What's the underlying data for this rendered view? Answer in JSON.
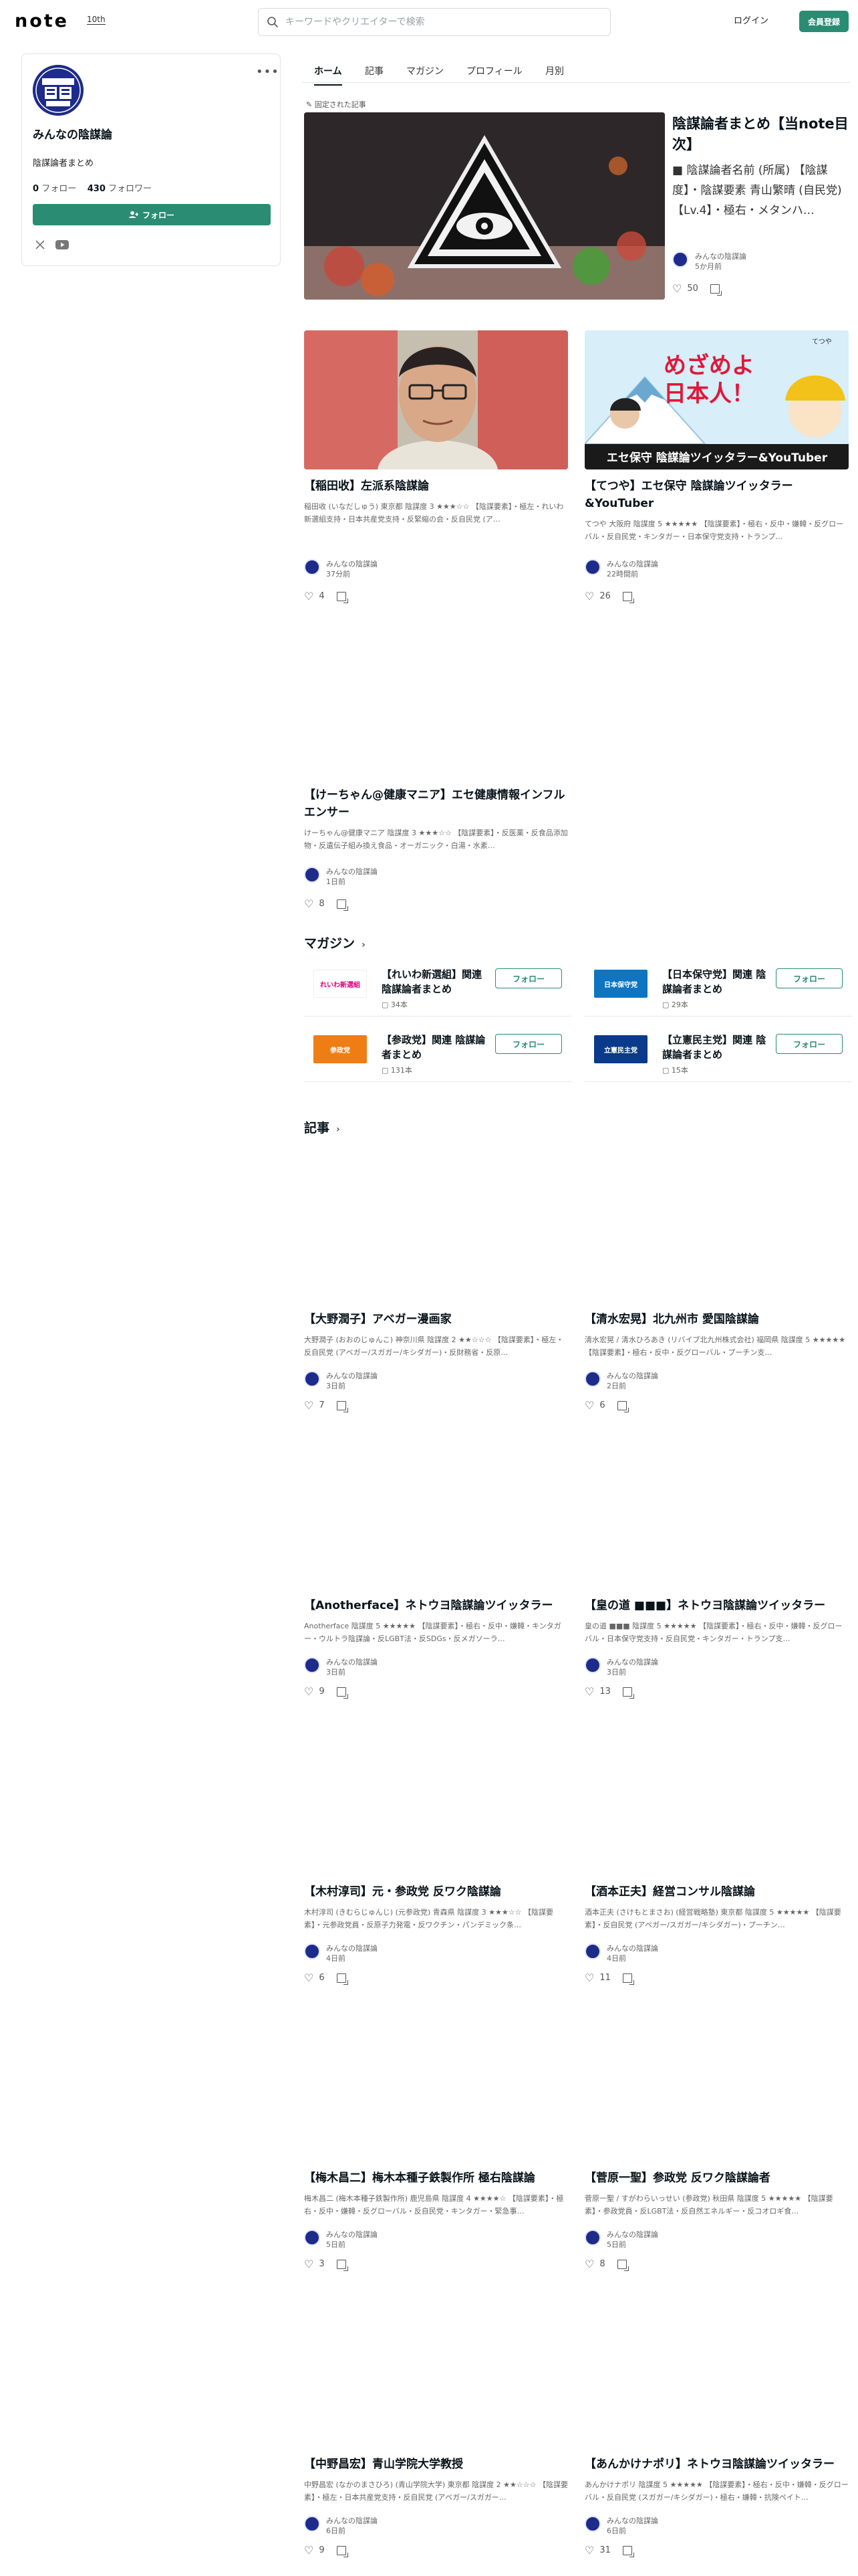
{
  "header": {
    "logo": "note",
    "logo_badge": "10th",
    "search_placeholder": "キーワードやクリエイターで検索",
    "login": "ログイン",
    "signup": "会員登録"
  },
  "profile": {
    "name": "みんなの陰謀論",
    "bio": "陰謀論者まとめ",
    "following_count": "0",
    "following_label": "フォロー",
    "followers_count": "430",
    "followers_label": "フォロワー",
    "follow_button": "フォロー",
    "avatar_text": "みんなの陰謀論"
  },
  "tabs": [
    "ホーム",
    "記事",
    "マガジン",
    "プロフィール",
    "月別"
  ],
  "featured": {
    "pinned_label": "固定された記事",
    "title": "陰謀論者まとめ【当note目次】",
    "desc": "■ 陰謀論者名前 (所属) 【陰謀度】・陰謀要素 青山繁晴 (自民党) 【Lv.4】・極右・メタンハ…",
    "author": "みんなの陰謀論",
    "time": "5か月前",
    "likes": "50"
  },
  "top_cards": [
    {
      "title": "【稲田收】左派系陰謀論",
      "desc": "稲田收 (いなだしゅう) 東京都 陰謀度 3 ★★★☆☆ 【陰謀要素】・極左・れいわ新選組支持・日本共産党支持・反緊縮の会・反自民党 (ア…",
      "author": "みんなの陰謀論",
      "time": "37分前",
      "likes": "4"
    },
    {
      "title": "【てつや】エセ保守 陰謀論ツイッタラー&YouTuber",
      "desc": "てつや 大阪府 陰謀度 5 ★★★★★ 【陰謀要素】・極右・反中・嫌韓・反グローバル・反自民党・キンタガー・日本保守党支持・トランプ…",
      "author": "みんなの陰謀論",
      "time": "22時間前",
      "likes": "26",
      "banner_main": "めざめよ\n日本人！",
      "banner_sub": "エセ保守 陰謀論ツイッタラー&YouTuber",
      "banner_tag": "てつや"
    },
    {
      "title": "【けーちゃん@健康マニア】エセ健康情報インフルエンサー",
      "desc": "けーちゃん@健康マニア 陰謀度 3 ★★★☆☆ 【陰謀要素】・反医薬・反食品添加物・反遺伝子組み換え食品・オーガニック・白湯・水素…",
      "author": "みんなの陰謀論",
      "time": "1日前",
      "likes": "8"
    }
  ],
  "magazine_section": {
    "heading": "マガジン",
    "items": [
      {
        "title": "【れいわ新選組】関連 陰謀論者まとめ",
        "count": "34本",
        "follow": "フォロー",
        "thumb": "れいわ新選組"
      },
      {
        "title": "【日本保守党】関連 陰謀論者まとめ",
        "count": "29本",
        "follow": "フォロー",
        "thumb": "日本保守党"
      },
      {
        "title": "【参政党】関連 陰謀論者まとめ",
        "count": "131本",
        "follow": "フォロー",
        "thumb": "参政党"
      },
      {
        "title": "【立憲民主党】関連 陰謀論者まとめ",
        "count": "15本",
        "follow": "フォロー",
        "thumb": "立憲民主党"
      }
    ]
  },
  "articles_section": {
    "heading": "記事",
    "items": [
      {
        "title": "【大野潤子】アベガー漫画家",
        "desc": "大野潤子 (おおのじゅんこ) 神奈川県 陰謀度 2 ★★☆☆☆ 【陰謀要素】・極左・反自民党 (アベガー/スガガー/キシダガー)・反財務省・反原…",
        "author": "みんなの陰謀論",
        "time": "3日前",
        "likes": "7"
      },
      {
        "title": "【清水宏晃】北九州市 愛国陰謀論",
        "desc": "清水宏晃 / 清水ひろあき (リバイブ北九州株式会社) 福岡県 陰謀度 5 ★★★★★ 【陰謀要素】・極右・反中・反グローバル・プーチン支…",
        "author": "みんなの陰謀論",
        "time": "2日前",
        "likes": "6"
      },
      {
        "title": "【Anotherface】ネトウヨ陰謀論ツイッタラー",
        "desc": "Anotherface 陰謀度 5 ★★★★★ 【陰謀要素】・極右・反中・嫌韓・キンタガー・ウルトラ陰謀論・反LGBT法・反SDGs・反メガソーラ…",
        "author": "みんなの陰謀論",
        "time": "3日前",
        "likes": "9"
      },
      {
        "title": "【皇の道 ■■■】ネトウヨ陰謀論ツイッタラー",
        "desc": "皇の道 ■■■ 陰謀度 5 ★★★★★ 【陰謀要素】・極右・反中・嫌韓・反グローバル・日本保守党支持・反自民党・キンタガー・トランプ支…",
        "author": "みんなの陰謀論",
        "time": "3日前",
        "likes": "13"
      },
      {
        "title": "【木村淳司】元・参政党 反ワク陰謀論",
        "desc": "木村淳司 (きむらじゅんじ) (元参政党) 青森県 陰謀度 3 ★★★☆☆ 【陰謀要素】・元参政党員・反原子力発電・反ワクチン・パンデミック条…",
        "author": "みんなの陰謀論",
        "time": "4日前",
        "likes": "6"
      },
      {
        "title": "【酒本正夫】経営コンサル陰謀論",
        "desc": "酒本正夫 (さけもとまさお) (経営戦略塾) 東京都 陰謀度 5 ★★★★★ 【陰謀要素】・反自民党 (アベガー/スガガー/キシダガー)・プーチン…",
        "author": "みんなの陰謀論",
        "time": "4日前",
        "likes": "11"
      },
      {
        "title": "【梅木昌二】梅木本種子鉄製作所 極右陰謀論",
        "desc": "梅木昌二 (梅木本種子鉄製作所) 鹿児島県 陰謀度 4 ★★★★☆ 【陰謀要素】・極右・反中・嫌韓・反グローバル・反自民党・キンタガー・緊急事…",
        "author": "みんなの陰謀論",
        "time": "5日前",
        "likes": "3"
      },
      {
        "title": "【菅原一聖】参政党 反ワク陰謀論者",
        "desc": "菅原一聖 / すがわらいっせい (参政党) 秋田県 陰謀度 5 ★★★★★ 【陰謀要素】・参政党員・反LGBT法・反自然エネルギー・反コオロギ食…",
        "author": "みんなの陰謀論",
        "time": "5日前",
        "likes": "8"
      },
      {
        "title": "【中野昌宏】青山学院大学教授",
        "desc": "中野昌宏 (なかのまさひろ) (青山学院大学) 東京都 陰謀度 2 ★★☆☆☆ 【陰謀要素】・極左・日本共産党支持・反自民党 (アベガー/スガガー…",
        "author": "みんなの陰謀論",
        "time": "6日前",
        "likes": "9"
      },
      {
        "title": "【あんかけナポリ】ネトウヨ陰謀論ツイッタラー",
        "desc": "あんかけナポリ 陰謀度 5 ★★★★★ 【陰謀要素】・極右・反中・嫌韓・反グローバル・反自民党 (スガガー/キシダガー)・極右・嫌韓・抗険ペイト…",
        "author": "みんなの陰謀論",
        "time": "6日前",
        "likes": "31"
      }
    ]
  },
  "colors": {
    "accent": "#2a8c72",
    "avatar_bg": "#1d2b8a",
    "text": "#08131a"
  },
  "icons": [
    "search-icon",
    "pin-icon",
    "heart-icon",
    "bookmark-icon",
    "more-icon",
    "x-icon",
    "youtube-icon",
    "chevron-right-icon",
    "magazine-icon",
    "person-add-icon"
  ]
}
